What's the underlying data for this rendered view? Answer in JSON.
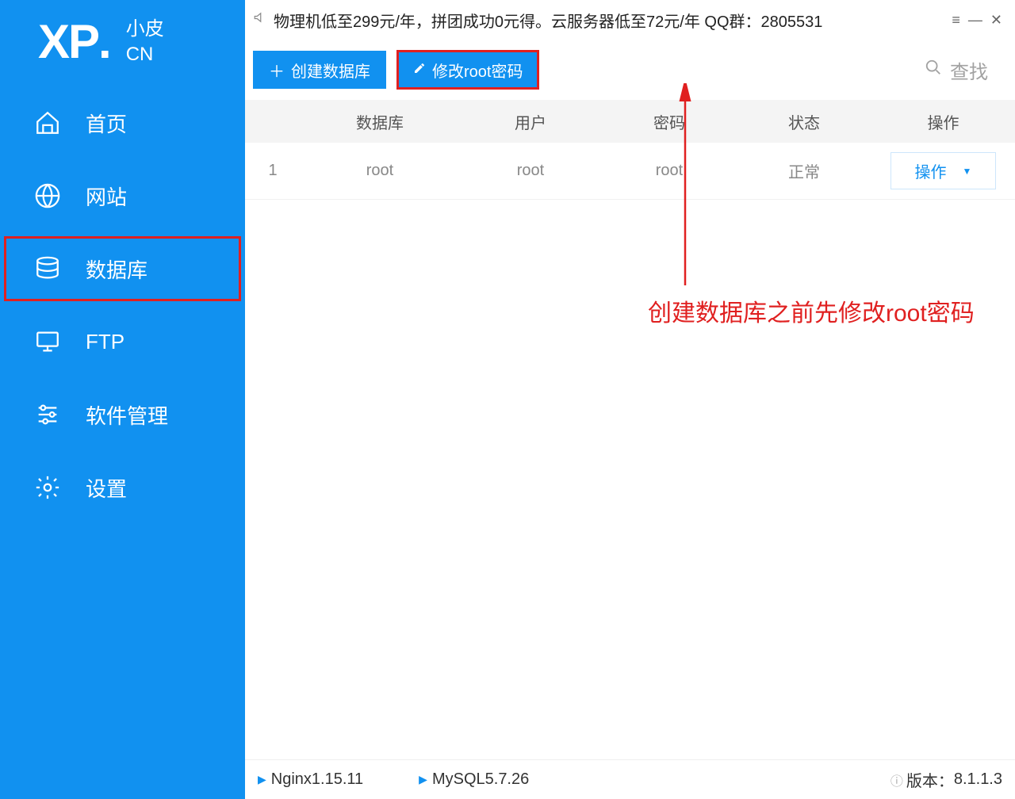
{
  "logo": {
    "main": "XP",
    "dot": ".",
    "cn_top": "小皮",
    "cn_bottom": "CN"
  },
  "sidebar": {
    "items": [
      {
        "label": "首页"
      },
      {
        "label": "网站"
      },
      {
        "label": "数据库"
      },
      {
        "label": "FTP"
      },
      {
        "label": "软件管理"
      },
      {
        "label": "设置"
      }
    ]
  },
  "titlebar": {
    "announcement": "物理机低至299元/年，拼团成功0元得。云服务器低至72元/年  QQ群：2805531"
  },
  "toolbar": {
    "create_db": "创建数据库",
    "change_root": "修改root密码",
    "search_placeholder": "查找"
  },
  "table": {
    "headers": {
      "db": "数据库",
      "user": "用户",
      "pwd": "密码",
      "status": "状态",
      "action": "操作"
    },
    "rows": [
      {
        "idx": "1",
        "db": "root",
        "user": "root",
        "pwd": "root",
        "status": "正常",
        "action": "操作"
      }
    ]
  },
  "annotation": {
    "text": "创建数据库之前先修改root密码"
  },
  "statusbar": {
    "nginx": "Nginx1.15.11",
    "mysql": "MySQL5.7.26",
    "version_label": "版本：",
    "version_value": "8.1.1.3"
  }
}
